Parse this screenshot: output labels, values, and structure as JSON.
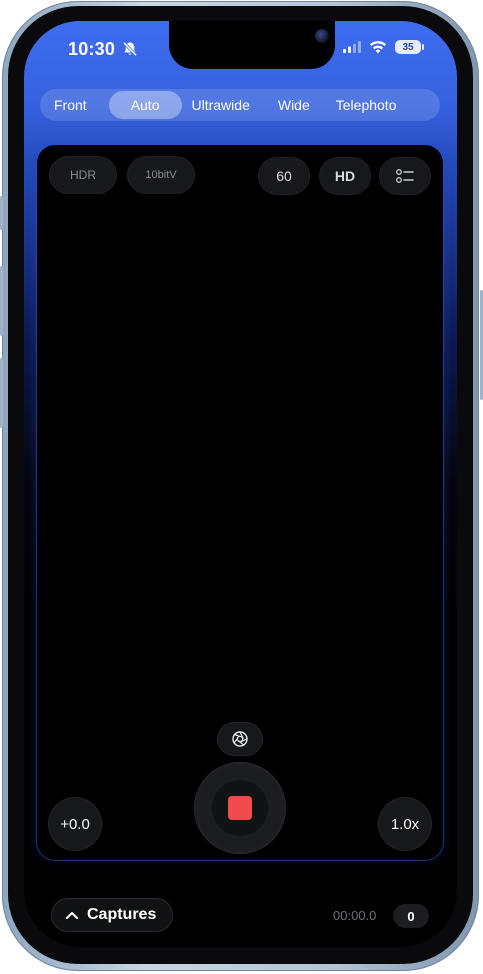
{
  "status_bar": {
    "time": "10:30",
    "battery_level": "35"
  },
  "lens_selector": {
    "tabs": [
      {
        "label": "Front",
        "active": false
      },
      {
        "label": "Auto",
        "active": true
      },
      {
        "label": "Ultrawide",
        "active": false
      },
      {
        "label": "Wide",
        "active": false
      },
      {
        "label": "Telephoto",
        "active": false
      }
    ]
  },
  "top_controls": {
    "hdr_label": "HDR",
    "bit_depth_label": "10bitV",
    "fps_label": "60",
    "resolution_label": "HD"
  },
  "bottom_controls": {
    "exposure_label": "+0.0",
    "zoom_label": "1.0x"
  },
  "footer": {
    "captures_label": "Captures",
    "timer": "00:00.0",
    "capture_count": "0"
  },
  "colors": {
    "accent_blue": "#3f6df0",
    "record_red": "#f24a4d"
  }
}
